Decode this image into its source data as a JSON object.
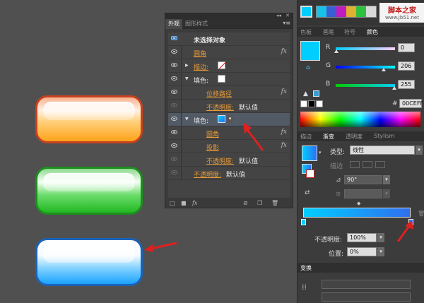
{
  "watermark": {
    "site_cn": "脚本之家",
    "site_url": "www.Jb51.net"
  },
  "appearance": {
    "tabs": [
      "外观",
      "图形样式"
    ],
    "heading": "未选择对象",
    "rows": [
      {
        "label": "圆角"
      },
      {
        "label": "描边:"
      },
      {
        "label": "填色:"
      },
      {
        "label": "位移路径"
      },
      {
        "label": "不透明度:",
        "value": "默认值"
      },
      {
        "label": "填色:"
      },
      {
        "label": "圆角"
      },
      {
        "label": "投影"
      },
      {
        "label": "不透明度:",
        "value": "默认值"
      },
      {
        "label": "不透明度:",
        "value": "默认值"
      }
    ],
    "fx": "fx"
  },
  "color_panel": {
    "tabs": [
      "色板",
      "画笔",
      "符号",
      "颜色"
    ],
    "r_label": "R",
    "g_label": "G",
    "b_label": "B",
    "r": "0",
    "g": "206",
    "b": "255",
    "hex_symbol": "#",
    "hex": "00CEFF"
  },
  "gradient_panel": {
    "tabs": [
      "描边",
      "渐变",
      "透明度",
      "Stylism"
    ],
    "type_label": "类型:",
    "type_value": "线性",
    "stroke_label": "描边",
    "angle_value": "90°",
    "opacity_label": "不透明度:",
    "opacity_value": "100%",
    "position_label": "位置:",
    "position_value": "0%",
    "colors": {
      "start": "#00CEFF",
      "end": "#2F6FEF"
    }
  },
  "transform_panel": {
    "tab": "变换"
  },
  "colors": {
    "accent_orange": "#E89A38",
    "arrow_red": "#E02020",
    "fill_blue": "#00CEFF"
  }
}
